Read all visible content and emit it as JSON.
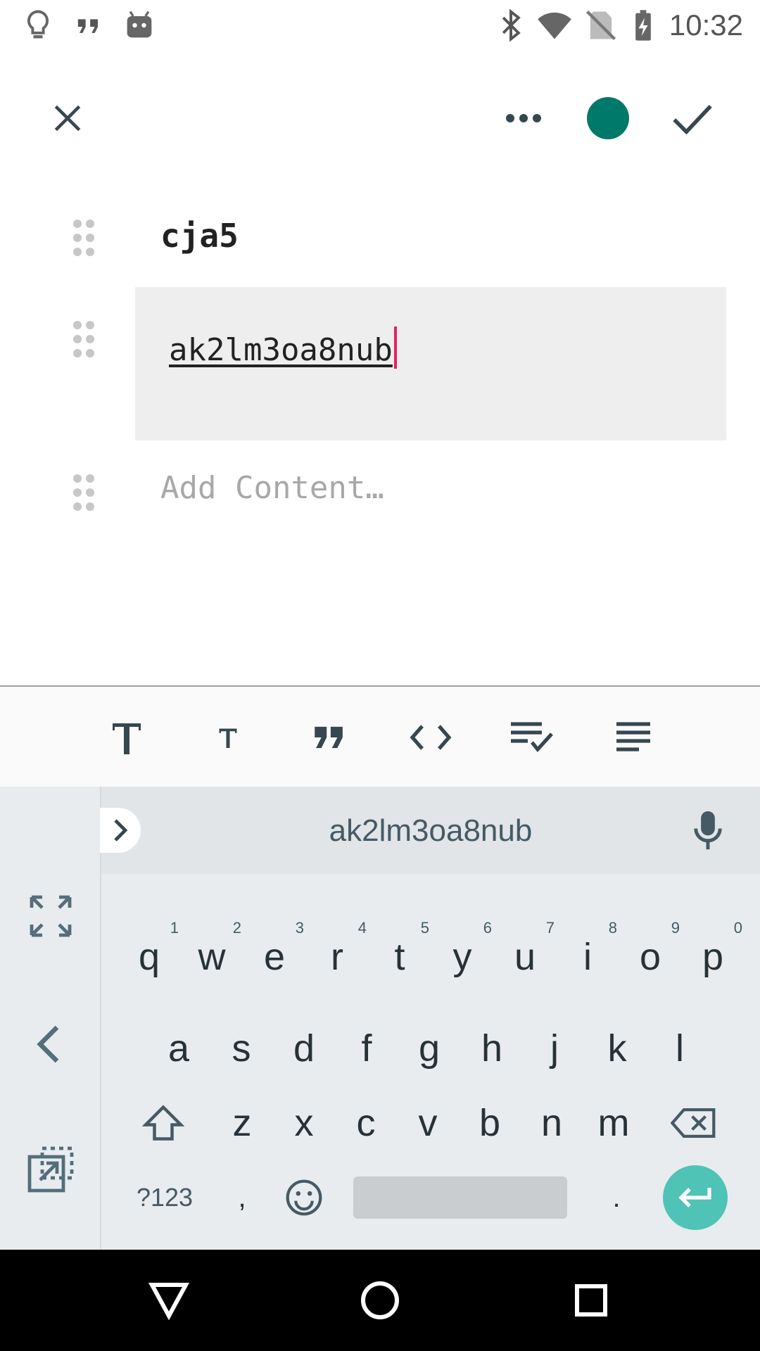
{
  "status_bar": {
    "time": "10:32",
    "left_icons": [
      "lightbulb-icon",
      "quote-icon",
      "android-icon"
    ],
    "right_icons": [
      "bluetooth-icon",
      "wifi-icon",
      "no-sim-icon",
      "battery-charging-icon"
    ]
  },
  "toolbar": {
    "close_icon": "close-icon",
    "more_icon": "more-horizontal-icon",
    "color": "#00796b",
    "confirm_icon": "check-icon"
  },
  "editor": {
    "title": "cja5",
    "content": "ak2lm3oa8nub",
    "add_placeholder": "Add Content…"
  },
  "format_bar": {
    "buttons": [
      "heading-large-icon",
      "heading-small-icon",
      "quote-icon",
      "code-icon",
      "checklist-icon",
      "paragraph-icon"
    ]
  },
  "keyboard": {
    "suggestion": "ak2lm3oa8nub",
    "row1": [
      {
        "k": "q",
        "h": "1"
      },
      {
        "k": "w",
        "h": "2"
      },
      {
        "k": "e",
        "h": "3"
      },
      {
        "k": "r",
        "h": "4"
      },
      {
        "k": "t",
        "h": "5"
      },
      {
        "k": "y",
        "h": "6"
      },
      {
        "k": "u",
        "h": "7"
      },
      {
        "k": "i",
        "h": "8"
      },
      {
        "k": "o",
        "h": "9"
      },
      {
        "k": "p",
        "h": "0"
      }
    ],
    "row2": [
      "a",
      "s",
      "d",
      "f",
      "g",
      "h",
      "j",
      "k",
      "l"
    ],
    "row3": [
      "z",
      "x",
      "c",
      "v",
      "b",
      "n",
      "m"
    ],
    "symbols_label": "?123",
    "comma": ",",
    "period": "."
  },
  "colors": {
    "accent": "#00796b",
    "caret": "#e91e63",
    "enter": "#4fc3b5"
  }
}
